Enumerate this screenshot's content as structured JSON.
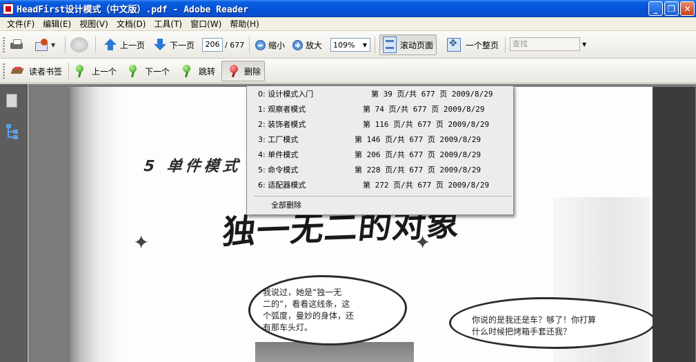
{
  "window": {
    "title": "HeadFirst设计模式（中文版）.pdf - Adobe Reader",
    "minimize": "_",
    "restore": "❐",
    "close": "✕"
  },
  "menu": [
    "文件(F)",
    "编辑(E)",
    "视图(V)",
    "文档(D)",
    "工具(T)",
    "窗口(W)",
    "帮助(H)"
  ],
  "toolbar": {
    "prev_page": "上一页",
    "next_page": "下一页",
    "current_page": "206",
    "total_pages": "/ 677",
    "zoom_out": "缩小",
    "zoom_in": "放大",
    "zoom_value": "109%",
    "scroll_page": "滚动页面",
    "full_page": "一个整页",
    "search_placeholder": "查找"
  },
  "bookmark_bar": {
    "reader_bookmarks": "读者书签",
    "previous": "上一个",
    "next": "下一个",
    "jump": "跳转",
    "delete": "删除"
  },
  "bookmark_menu": {
    "items": [
      {
        "label": "0: 设计模式入门",
        "info": "第 39 页/共 677 页 2009/8/29"
      },
      {
        "label": "1: 观察者模式",
        "info": "第 74 页/共 677 页 2009/8/29"
      },
      {
        "label": "2: 装饰者模式",
        "info": "第 116 页/共 677 页 2009/8/29"
      },
      {
        "label": "3: 工厂模式",
        "info": "第 146 页/共 677 页 2009/8/29"
      },
      {
        "label": "4: 单件模式",
        "info": "第 206 页/共 677 页 2009/8/29"
      },
      {
        "label": "5: 命令模式",
        "info": "第 228 页/共 677 页 2009/8/29"
      },
      {
        "label": "6: 适配器模式",
        "info": "第 272 页/共 677 页 2009/8/29"
      }
    ],
    "delete_all": "全部删除"
  },
  "document": {
    "chapter": "5 单件模式",
    "title": "独一无二的对象",
    "bubble_left": [
      "我说过，她是“独一无",
      "二的”，看看这线条，这",
      "个弧度，曼妙的身体，还",
      "有那车头灯。"
    ],
    "bubble_right": [
      "你说的是我还是车？够了！你打算",
      "什么时候把烤箱手套还我？"
    ]
  },
  "colors": {
    "titlebar": "#0553d8",
    "doc_background": "#7b7b7b",
    "left_panel": "#5d5d5d"
  }
}
